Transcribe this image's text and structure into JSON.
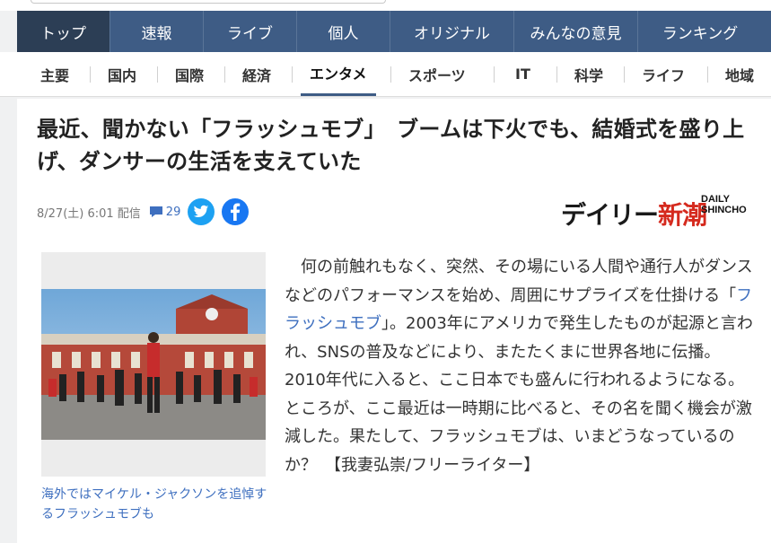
{
  "main_nav": [
    "トップ",
    "速報",
    "ライブ",
    "個人",
    "オリジナル",
    "みんなの意見",
    "ランキング"
  ],
  "sub_nav": [
    "主要",
    "国内",
    "国際",
    "経済",
    "エンタメ",
    "スポーツ",
    "IT",
    "科学",
    "ライフ",
    "地域"
  ],
  "article": {
    "title": "最近、聞かない「フラッシュモブ」　ブームは下火でも、結婚式を盛り上げ、ダンサーの生活を支えていた",
    "date": "8/27(土) 6:01 配信",
    "comment_count": "29",
    "publisher_logo": {
      "jp_part1": "デイリー",
      "jp_part2": "新潮",
      "en_line1": "DAILY",
      "en_line2": "SHINCHO"
    },
    "image_caption": "海外ではマイケル・ジャクソンを追悼するフラッシュモブも",
    "body_before_link": "何の前触れもなく、突然、その場にいる人間や通行人がダンスなどのパフォーマンスを始め、周囲にサプライズを仕掛ける「",
    "body_link": "フラッシュモブ",
    "body_after_link": "」。2003年にアメリカで発生したものが起源と言われ、SNSの普及などにより、またたくまに世界各地に伝播。2010年代に入ると、ここ日本でも盛んに行われるようになる。ところが、ここ最近は一時期に比べると、その名を聞く機会が激減した。果たして、フラッシュモブは、いまどうなっているのか？　【我妻弘崇/フリーライター】"
  },
  "colors": {
    "nav_bg": "#3e5c85",
    "nav_active": "#2c3e55",
    "link": "#3e6fbf",
    "twitter": "#1da1f2",
    "facebook": "#1877f2",
    "logo_red": "#d52a1e"
  },
  "icons": {
    "comment": "speech-bubble-icon",
    "twitter": "twitter-bird-icon",
    "facebook": "facebook-f-icon"
  }
}
